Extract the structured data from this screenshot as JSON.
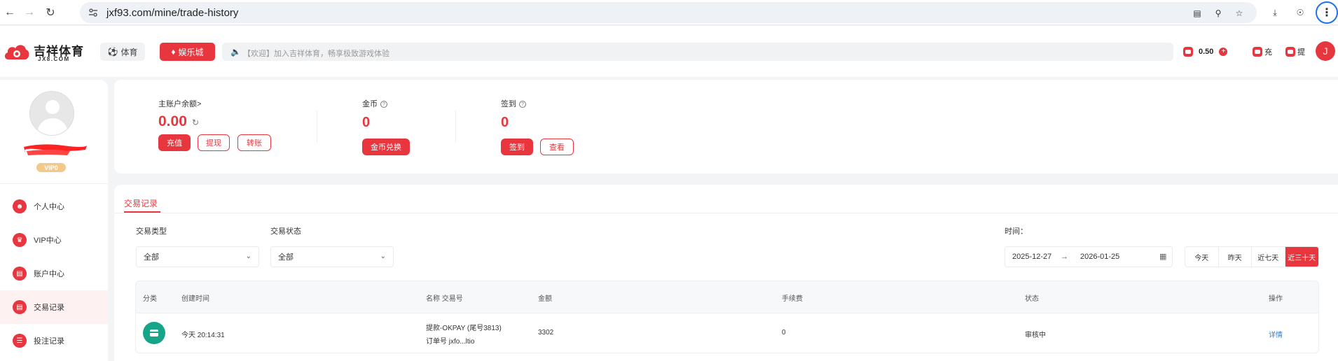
{
  "browser": {
    "url": "jxf93.com/mine/trade-history"
  },
  "header": {
    "logo_cn": "吉祥体育",
    "logo_en": "JX8.COM",
    "nav_sports": "体育",
    "nav_casino": "娱乐城",
    "marquee": "【欢迎】加入吉祥体育，畅享极致游戏体验",
    "balance": "0.50",
    "deposit_short": "充",
    "withdraw_short": "提",
    "avatar_letter": "J"
  },
  "profile": {
    "vip_label": "VIP0"
  },
  "sidebar": {
    "items": [
      {
        "label": "个人中心",
        "icon": "user-icon"
      },
      {
        "label": "VIP中心",
        "icon": "crown-icon"
      },
      {
        "label": "账户中心",
        "icon": "wallet-icon"
      },
      {
        "label": "交易记录",
        "icon": "records-icon",
        "active": true
      },
      {
        "label": "投注记录",
        "icon": "bet-icon"
      }
    ]
  },
  "stats": {
    "main_balance_label": "主账户余额>",
    "main_balance": "0.00",
    "btn_deposit": "充值",
    "btn_withdraw": "提现",
    "btn_transfer": "转账",
    "coins_label": "金币",
    "coins_value": "0",
    "btn_exchange": "金币兑换",
    "checkin_label": "签到",
    "checkin_value": "0",
    "btn_checkin": "签到",
    "btn_view": "查看"
  },
  "main": {
    "tab_title": "交易记录",
    "filter_type_label": "交易类型",
    "filter_type_value": "全部",
    "filter_status_label": "交易状态",
    "filter_status_value": "全部",
    "time_label": "时间：",
    "date_start": "2025-12-27",
    "date_arrow": "→",
    "date_end": "2026-01-25",
    "quick_ranges": [
      "今天",
      "昨天",
      "近七天",
      "近三十天"
    ],
    "quick_active_index": 3
  },
  "table": {
    "headers": [
      "分类",
      "创建时间",
      "名称 交易号",
      "金额",
      "手续费",
      "状态",
      "操作"
    ],
    "rows": [
      {
        "created": "今天 20:14:31",
        "name": "提款-OKPAY (尾号3813)",
        "order": "订单号 jxfo...ltio",
        "amount": "3302",
        "fee": "0",
        "status": "审核中",
        "action": "详情"
      }
    ]
  },
  "colors": {
    "accent": "#e8363f",
    "link": "#2b7be0",
    "category_icon": "#17a589"
  }
}
